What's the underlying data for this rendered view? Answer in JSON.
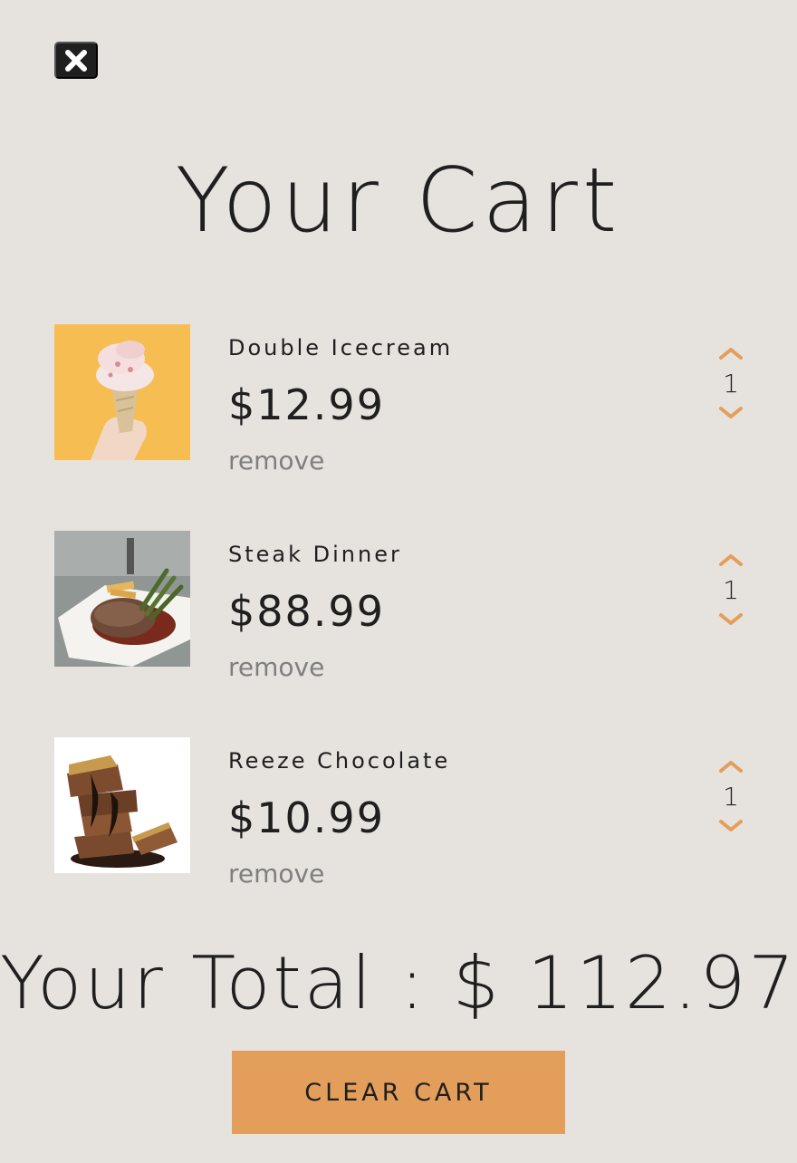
{
  "header": {
    "close_icon": "close-icon",
    "title": "Your Cart"
  },
  "colors": {
    "background": "#e6e2de",
    "accent": "#e39e5b",
    "text": "#1f1f1f",
    "muted": "#7f7f7f"
  },
  "cart": {
    "items": [
      {
        "name": "Double Icecream",
        "price": "$12.99",
        "remove_label": "remove",
        "quantity": "1",
        "image": "icecream-image"
      },
      {
        "name": "Steak Dinner",
        "price": "$88.99",
        "remove_label": "remove",
        "quantity": "1",
        "image": "steak-image"
      },
      {
        "name": "Reeze Chocolate",
        "price": "$10.99",
        "remove_label": "remove",
        "quantity": "1",
        "image": "chocolate-image"
      }
    ]
  },
  "total": {
    "text": "Your Total : $ 112.97"
  },
  "actions": {
    "clear_label": "CLEAR CART"
  }
}
